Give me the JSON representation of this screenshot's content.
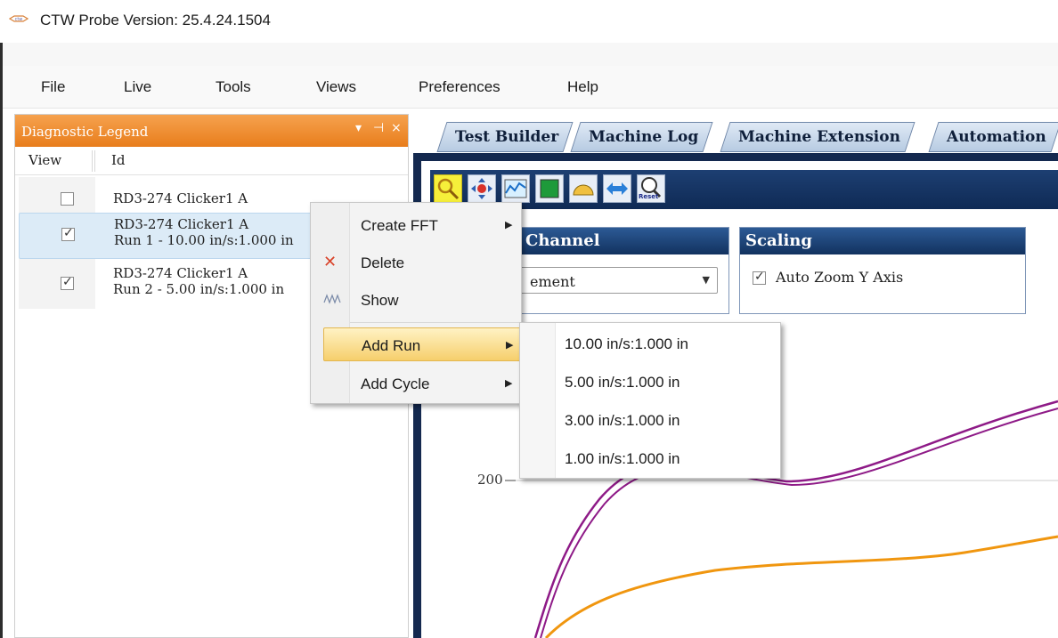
{
  "window": {
    "title": "CTW Probe Version: 25.4.24.1504"
  },
  "menubar": {
    "items": [
      "File",
      "Live",
      "Tools",
      "Views",
      "Preferences",
      "Help"
    ]
  },
  "legend": {
    "title": "Diagnostic Legend",
    "header_buttons": [
      "▾",
      "⊣",
      "×"
    ],
    "columns": [
      "View",
      "Id"
    ],
    "rows": [
      {
        "line1": "RD3-274 Clicker1 A",
        "line2": "",
        "checked": false
      },
      {
        "line1": "RD3-274 Clicker1 A",
        "line2": "Run 1 - 10.00 in/s:1.000 in",
        "checked": true
      },
      {
        "line1": "RD3-274 Clicker1 A",
        "line2": "Run 2 - 5.00 in/s:1.000 in",
        "checked": true
      }
    ]
  },
  "tabs": [
    "Test Builder",
    "Machine Log",
    "Machine Extension",
    "Automation"
  ],
  "toolbar": {
    "buttons": [
      "zoom-icon",
      "pan-icon",
      "chart-icon",
      "fill-icon",
      "protractor-icon",
      "horizontal-arrows-icon",
      "reset-zoom-icon"
    ],
    "reset_label": "Reset"
  },
  "channel_group": {
    "title": "Channel",
    "selected": "ement"
  },
  "scaling_group": {
    "title": "Scaling",
    "auto_zoom_label": "Auto Zoom Y Axis",
    "auto_zoom_checked": true
  },
  "plot": {
    "y_tick": "200"
  },
  "context_menu": {
    "items": [
      {
        "label": "Create FFT",
        "icon": "",
        "submenu": true
      },
      {
        "label": "Delete",
        "icon": "delete-x-icon",
        "submenu": false
      },
      {
        "label": "Show",
        "icon": "show-waveform-icon",
        "submenu": false
      },
      {
        "label": "Add Run",
        "icon": "",
        "submenu": true
      },
      {
        "label": "Add Cycle",
        "icon": "",
        "submenu": true
      }
    ]
  },
  "submenu": {
    "items": [
      "10.00 in/s:1.000 in",
      "5.00 in/s:1.000 in",
      "3.00 in/s:1.000 in",
      "1.00 in/s:1.000 in"
    ]
  },
  "colors": {
    "legend_header": "#e87d1c",
    "tab_frame": "#14294f",
    "series_purple": "#8e1a87",
    "series_orange": "#f0960f",
    "menu_highlight": "#f6cf6c"
  }
}
